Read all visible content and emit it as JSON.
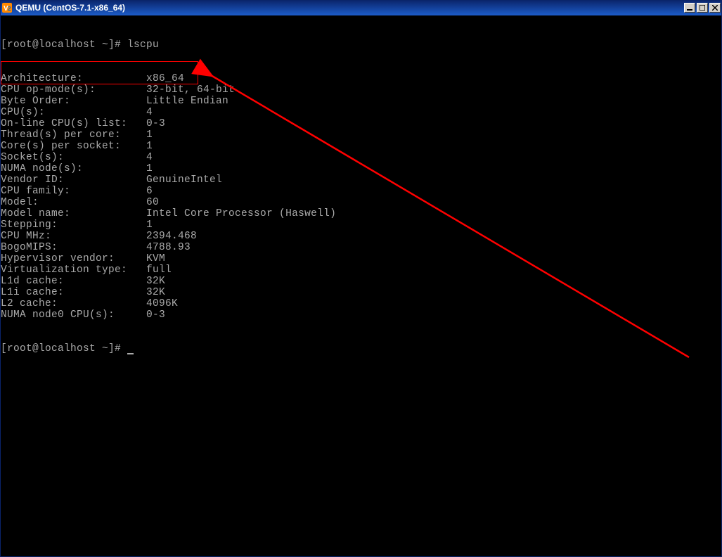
{
  "window": {
    "title": "QEMU (CentOS-7.1-x86_64)"
  },
  "terminal": {
    "prompt1": "[root@localhost ~]# lscpu",
    "lines": [
      {
        "label": "Architecture:",
        "value": "x86_64"
      },
      {
        "label": "CPU op-mode(s):",
        "value": "32-bit, 64-bit"
      },
      {
        "label": "Byte Order:",
        "value": "Little Endian"
      },
      {
        "label": "CPU(s):",
        "value": "4"
      },
      {
        "label": "On-line CPU(s) list:",
        "value": "0-3"
      },
      {
        "label": "Thread(s) per core:",
        "value": "1"
      },
      {
        "label": "Core(s) per socket:",
        "value": "1"
      },
      {
        "label": "Socket(s):",
        "value": "4"
      },
      {
        "label": "NUMA node(s):",
        "value": "1"
      },
      {
        "label": "Vendor ID:",
        "value": "GenuineIntel"
      },
      {
        "label": "CPU family:",
        "value": "6"
      },
      {
        "label": "Model:",
        "value": "60"
      },
      {
        "label": "Model name:",
        "value": "Intel Core Processor (Haswell)"
      },
      {
        "label": "Stepping:",
        "value": "1"
      },
      {
        "label": "CPU MHz:",
        "value": "2394.468"
      },
      {
        "label": "BogoMIPS:",
        "value": "4788.93"
      },
      {
        "label": "Hypervisor vendor:",
        "value": "KVM"
      },
      {
        "label": "Virtualization type:",
        "value": "full"
      },
      {
        "label": "L1d cache:",
        "value": "32K"
      },
      {
        "label": "L1i cache:",
        "value": "32K"
      },
      {
        "label": "L2 cache:",
        "value": "4096K"
      },
      {
        "label": "NUMA node0 CPU(s):",
        "value": "0-3"
      }
    ],
    "prompt2": "[root@localhost ~]# "
  }
}
